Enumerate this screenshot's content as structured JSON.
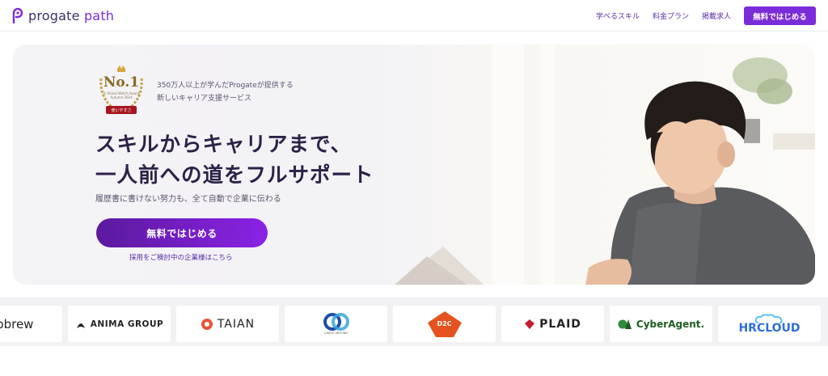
{
  "header": {
    "logo_name": "progate",
    "logo_suffix": "path",
    "nav": [
      "学べるスキル",
      "料金プラン",
      "掲載求人"
    ],
    "cta_label": "無料ではじめる"
  },
  "hero": {
    "award": {
      "rank": "No.1",
      "line1": "© Brand Watch Award",
      "line2": "Autumn 2024",
      "ribbon": "使いやすさ"
    },
    "caption_line1": "350万人以上が学んだProgateが提供する",
    "caption_line2": "新しいキャリア支援サービス",
    "headline_line1": "スキルからキャリアまで、",
    "headline_line2": "一人前への道をフルサポート",
    "subline": "履歴書に書けない努力も、全て自動で企業に伝わる",
    "cta_label": "無料ではじめる",
    "corp_link": "採用をご検討中の企業様はこちら"
  },
  "logos": [
    {
      "name": "ppbrew",
      "color": "#222222"
    },
    {
      "name": "ANIMA GROUP",
      "color": "#222222"
    },
    {
      "name": "TAIAN",
      "color": "#222222"
    },
    {
      "name": "CIRCLE AROUND",
      "color": "#3a6fc4"
    },
    {
      "name": "D2C",
      "color": "#ffffff"
    },
    {
      "name": "PLAID",
      "color": "#222222"
    },
    {
      "name": "CyberAgent.",
      "color": "#1b5e20"
    },
    {
      "name": "HRCLOUD",
      "color": "#2f6fd6"
    }
  ],
  "colors": {
    "brand": "#7b2cd9",
    "dark": "#2d2148"
  }
}
